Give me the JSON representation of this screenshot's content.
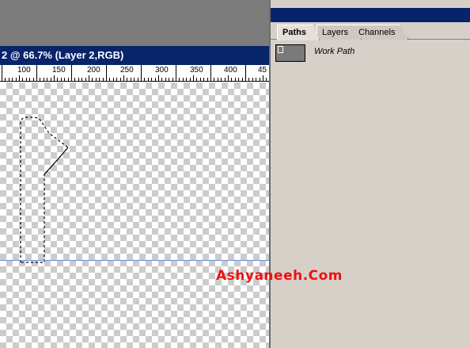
{
  "document": {
    "title": "2 @ 66.7% (Layer 2,RGB)"
  },
  "ruler": {
    "labels": [
      "100",
      "150",
      "200",
      "250",
      "300",
      "350",
      "400",
      "45"
    ]
  },
  "palette": {
    "tabs": [
      {
        "label": "Paths",
        "active": true
      },
      {
        "label": "Layers",
        "active": false
      },
      {
        "label": "Channels",
        "active": false
      }
    ],
    "paths": [
      {
        "name": "Work Path"
      }
    ]
  },
  "watermark": {
    "text": "Ashyaneeh.Com",
    "color": "#ee1111"
  },
  "colors": {
    "title_bar": "#08246b",
    "palette_bg": "#d7d0c9",
    "guide": "#6f8fd8"
  }
}
